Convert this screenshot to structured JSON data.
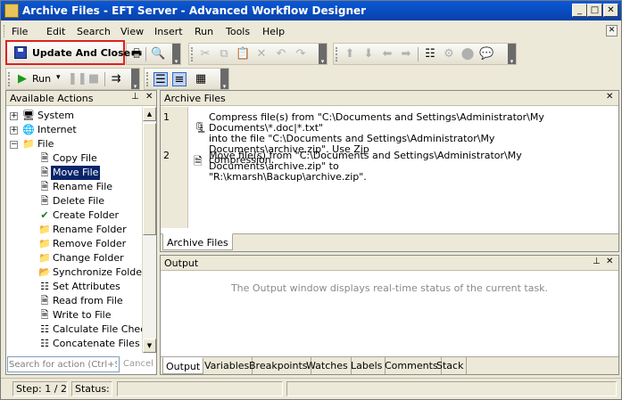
{
  "window": {
    "title": "Archive Files - EFT Server - Advanced Workflow Designer",
    "minimize": "_",
    "maximize": "□",
    "close": "✕"
  },
  "menu": [
    "File",
    "Edit",
    "Search",
    "View",
    "Insert",
    "Run",
    "Tools",
    "Help"
  ],
  "menu_close": "✕",
  "toolbar": {
    "update_close_label": "Update And Close",
    "run_label": "Run",
    "run_dropdown": "▾"
  },
  "icons": {
    "save": "save-icon",
    "print": "print-icon",
    "find": "find-icon",
    "cut": "cut-icon",
    "copy": "copy-icon",
    "paste": "paste-icon",
    "delete": "delete-icon",
    "undo": "undo-icon",
    "redo": "redo-icon",
    "step_over": "step-icon",
    "breakpoint": "breakpoint-icon",
    "comment": "comment-icon",
    "pause": "pause-icon",
    "stop": "stop-icon"
  },
  "left_panel": {
    "title": "Available Actions",
    "pin": "📌",
    "close": "✕",
    "tree": [
      {
        "label": "System",
        "level": 0,
        "expander": "+",
        "selected": false
      },
      {
        "label": "Internet",
        "level": 0,
        "expander": "+",
        "selected": false
      },
      {
        "label": "File",
        "level": 0,
        "expander": "−",
        "selected": false
      },
      {
        "label": "Copy File",
        "level": 1,
        "selected": false
      },
      {
        "label": "Move File",
        "level": 1,
        "selected": true
      },
      {
        "label": "Rename File",
        "level": 1,
        "selected": false
      },
      {
        "label": "Delete File",
        "level": 1,
        "selected": false
      },
      {
        "label": "Create Folder",
        "level": 1,
        "selected": false
      },
      {
        "label": "Rename Folder",
        "level": 1,
        "selected": false
      },
      {
        "label": "Remove Folder",
        "level": 1,
        "selected": false
      },
      {
        "label": "Change Folder",
        "level": 1,
        "selected": false
      },
      {
        "label": "Synchronize Folders",
        "level": 1,
        "selected": false
      },
      {
        "label": "Set Attributes",
        "level": 1,
        "selected": false
      },
      {
        "label": "Read from File",
        "level": 1,
        "selected": false
      },
      {
        "label": "Write to File",
        "level": 1,
        "selected": false
      },
      {
        "label": "Calculate File Checksum",
        "level": 1,
        "selected": false
      },
      {
        "label": "Concatenate Files",
        "level": 1,
        "selected": false
      }
    ],
    "search_placeholder": "Search for action (Ctrl+S)",
    "cancel_label": "Cancel"
  },
  "editor": {
    "title": "Archive Files",
    "close": "✕",
    "steps": [
      {
        "number": "1",
        "lines": [
          "Compress file(s) from \"C:\\Documents and Settings\\Administrator\\My Documents\\*.doc|*.txt\"",
          "into the file \"C:\\Documents and Settings\\Administrator\\My Documents\\archive.zip\".  Use Zip",
          "compression."
        ]
      },
      {
        "number": "2",
        "lines": [
          "Move file(s) from \"C:\\Documents and Settings\\Administrator\\My Documents\\archive.zip\" to",
          "\"R:\\kmarsh\\Backup\\archive.zip\"."
        ]
      }
    ],
    "doc_tab": "Archive Files"
  },
  "output": {
    "title": "Output",
    "pin": "📌",
    "close": "✕",
    "message": "The Output window displays real-time status of the current task.",
    "tabs": [
      "Output",
      "Variables",
      "Breakpoints",
      "Watches",
      "Labels",
      "Comments",
      "Stack"
    ]
  },
  "status": {
    "step": "Step: 1 / 2",
    "status_label": "Status:",
    "status_value": ""
  }
}
